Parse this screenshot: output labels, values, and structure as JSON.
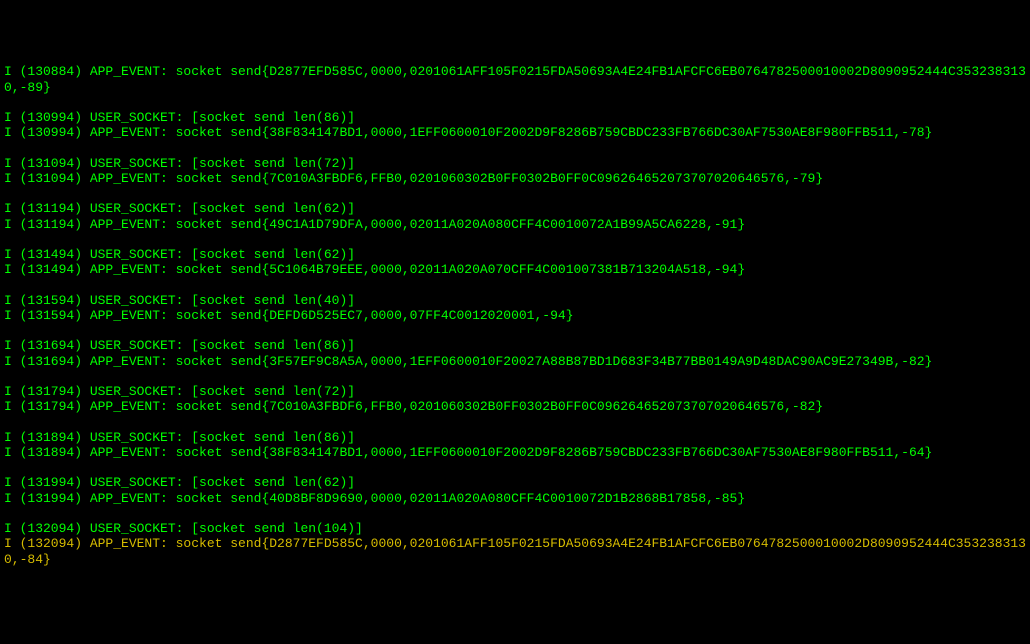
{
  "lines": [
    {
      "cls": "log-line",
      "text": "I (130884) APP_EVENT: socket send{D2877EFD585C,0000,0201061AFF105F0215FDA50693A4E24FB1AFCFC6EB0764782500010002D8090952444C3532383130,-89}"
    },
    {
      "cls": "blank",
      "text": ""
    },
    {
      "cls": "log-line",
      "text": "I (130994) USER_SOCKET: [socket send len(86)]"
    },
    {
      "cls": "log-line",
      "text": "I (130994) APP_EVENT: socket send{38F834147BD1,0000,1EFF0600010F2002D9F8286B759CBDC233FB766DC30AF7530AE8F980FFB511,-78}"
    },
    {
      "cls": "blank",
      "text": ""
    },
    {
      "cls": "log-line",
      "text": "I (131094) USER_SOCKET: [socket send len(72)]"
    },
    {
      "cls": "log-line",
      "text": "I (131094) APP_EVENT: socket send{7C010A3FBDF6,FFB0,0201060302B0FF0302B0FF0C096264652073707020646576,-79}"
    },
    {
      "cls": "blank",
      "text": ""
    },
    {
      "cls": "log-line",
      "text": "I (131194) USER_SOCKET: [socket send len(62)]"
    },
    {
      "cls": "log-line",
      "text": "I (131194) APP_EVENT: socket send{49C1A1D79DFA,0000,02011A020A080CFF4C0010072A1B99A5CA6228,-91}"
    },
    {
      "cls": "blank",
      "text": ""
    },
    {
      "cls": "log-line",
      "text": "I (131494) USER_SOCKET: [socket send len(62)]"
    },
    {
      "cls": "log-line",
      "text": "I (131494) APP_EVENT: socket send{5C1064B79EEE,0000,02011A020A070CFF4C001007381B713204A518,-94}"
    },
    {
      "cls": "blank",
      "text": ""
    },
    {
      "cls": "log-line",
      "text": "I (131594) USER_SOCKET: [socket send len(40)]"
    },
    {
      "cls": "log-line",
      "text": "I (131594) APP_EVENT: socket send{DEFD6D525EC7,0000,07FF4C0012020001,-94}"
    },
    {
      "cls": "blank",
      "text": ""
    },
    {
      "cls": "log-line",
      "text": "I (131694) USER_SOCKET: [socket send len(86)]"
    },
    {
      "cls": "log-line",
      "text": "I (131694) APP_EVENT: socket send{3F57EF9C8A5A,0000,1EFF0600010F20027A88B87BD1D683F34B77BB0149A9D48DAC90AC9E27349B,-82}"
    },
    {
      "cls": "blank",
      "text": ""
    },
    {
      "cls": "log-line",
      "text": "I (131794) USER_SOCKET: [socket send len(72)]"
    },
    {
      "cls": "log-line",
      "text": "I (131794) APP_EVENT: socket send{7C010A3FBDF6,FFB0,0201060302B0FF0302B0FF0C096264652073707020646576,-82}"
    },
    {
      "cls": "blank",
      "text": ""
    },
    {
      "cls": "log-line",
      "text": "I (131894) USER_SOCKET: [socket send len(86)]"
    },
    {
      "cls": "log-line",
      "text": "I (131894) APP_EVENT: socket send{38F834147BD1,0000,1EFF0600010F2002D9F8286B759CBDC233FB766DC30AF7530AE8F980FFB511,-64}"
    },
    {
      "cls": "blank",
      "text": ""
    },
    {
      "cls": "log-line",
      "text": "I (131994) USER_SOCKET: [socket send len(62)]"
    },
    {
      "cls": "log-line",
      "text": "I (131994) APP_EVENT: socket send{40D8BF8D9690,0000,02011A020A080CFF4C0010072D1B2868B17858,-85}"
    },
    {
      "cls": "blank",
      "text": ""
    },
    {
      "cls": "log-line",
      "text": "I (132094) USER_SOCKET: [socket send len(104)]"
    },
    {
      "cls": "log-warn",
      "text": "I (132094) APP_EVENT: socket send{D2877EFD585C,0000,0201061AFF105F0215FDA50693A4E24FB1AFCFC6EB0764782500010002D8090952444C3532383130,-84}"
    }
  ]
}
